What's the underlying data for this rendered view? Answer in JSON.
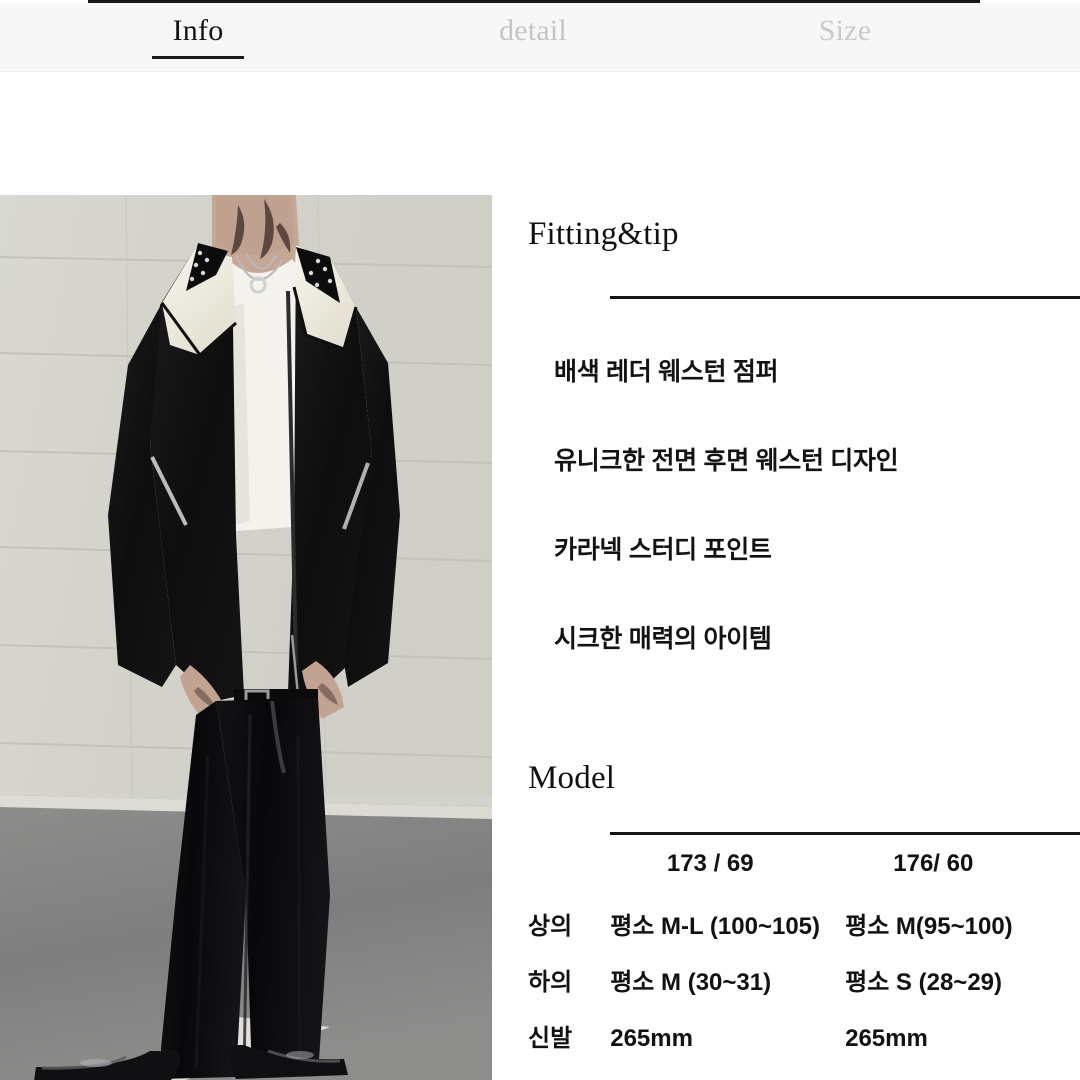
{
  "tabs": [
    {
      "label": "Info",
      "active": true,
      "name": "tab-info"
    },
    {
      "label": "detail",
      "active": false,
      "name": "tab-detail"
    },
    {
      "label": "Size",
      "active": false,
      "name": "tab-size"
    }
  ],
  "tab_labels": {
    "info": "Info",
    "detail": "detail",
    "size": "Size"
  },
  "product_photo": {
    "alt": "Model wearing black western jacket with cream yoke panels and studded collar, black trousers and glossy black square-toe shoes",
    "colors": {
      "wall": "#d6d6cf",
      "floor": "#868686",
      "jacket_black": "#121212",
      "jacket_cream": "#f2efe5",
      "tshirt_white": "#f4f2ec",
      "floor_line": "#e9e7e0"
    }
  },
  "fitting": {
    "heading": "Fitting&tip",
    "lines": [
      "배색 레더 웨스턴 점퍼",
      "유니크한 전면 후면 웨스턴 디자인",
      "카라넥 스터디 포인트",
      "시크한 매력의 아이템"
    ]
  },
  "model": {
    "heading": "Model",
    "columns": [
      "173 / 69",
      "176/ 60"
    ],
    "rows": [
      {
        "label": "상의",
        "values": [
          "평소 M-L (100~105)",
          "평소 M(95~100)"
        ]
      },
      {
        "label": "하의",
        "values": [
          "평소 M (30~31)",
          "평소 S (28~29)"
        ]
      },
      {
        "label": "신발",
        "values": [
          "265mm",
          "265mm"
        ]
      }
    ]
  },
  "colors": {
    "text": "#121212",
    "tab_inactive": "#c6c6c6",
    "tabbar_bg": "#f7f7f7",
    "rule": "#141414",
    "page_bg": "#ffffff"
  }
}
